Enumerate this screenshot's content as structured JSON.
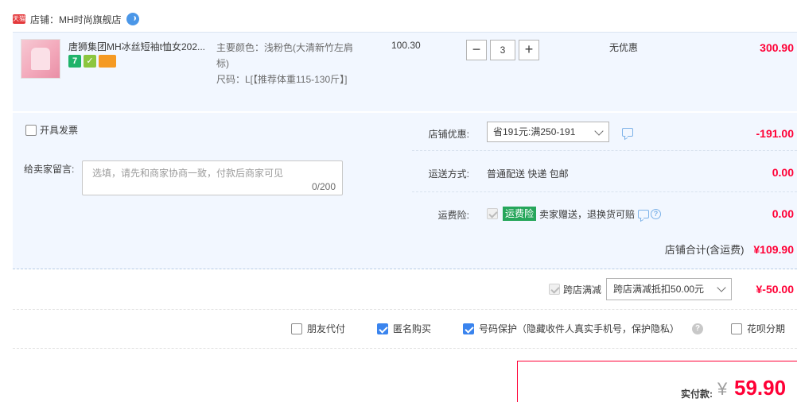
{
  "shop": {
    "badge": "天猫",
    "name": "店铺：MH时尚旗舰店"
  },
  "item": {
    "title": "唐狮集团MH冰丝短袖t恤女202...",
    "service_icons": [
      "7",
      "✓",
      ""
    ],
    "sku_color": "主要颜色：浅粉色(大清新竹左肩标)",
    "sku_size": "尺码：L[【推荐体重115-130斤】]",
    "unit_price": "100.30",
    "quantity": "3",
    "qty_minus": "−",
    "qty_plus": "+",
    "discount": "无优惠",
    "subtotal": "300.90"
  },
  "invoice": {
    "label": "开具发票",
    "checked": false
  },
  "message": {
    "label": "给卖家留言:",
    "placeholder": "选填，请先和商家协商一致，付款后商家可见",
    "count": "0/200"
  },
  "shop_promo": {
    "label": "店铺优惠:",
    "selected": "省191元:满250-191",
    "amount": "-191.00"
  },
  "shipping": {
    "label": "运送方式:",
    "value": "普通配送 快递 包邮",
    "amount": "0.00"
  },
  "insurance": {
    "label": "运费险:",
    "badge": "运费险",
    "text": "卖家赠送，退换货可赔",
    "amount": "0.00"
  },
  "shop_total": {
    "label": "店铺合计(含运费)",
    "value": "¥109.90"
  },
  "cross_shop": {
    "label": "跨店满减",
    "selected": "跨店满减抵扣50.00元",
    "amount": "¥-50.00"
  },
  "options": {
    "friend_pay": "朋友代付",
    "anonymous": "匿名购买",
    "number_protect": "号码保护（隐藏收件人真实手机号，保护隐私）",
    "huabei": "花呗分期"
  },
  "payment": {
    "label": "实付款:",
    "currency": "¥",
    "value": "59.90"
  },
  "colors": {
    "accent_red": "#ff0036",
    "panel_bg": "#f2f7ff",
    "check_blue": "#3a84ee",
    "insurance_green": "#26a65b"
  }
}
